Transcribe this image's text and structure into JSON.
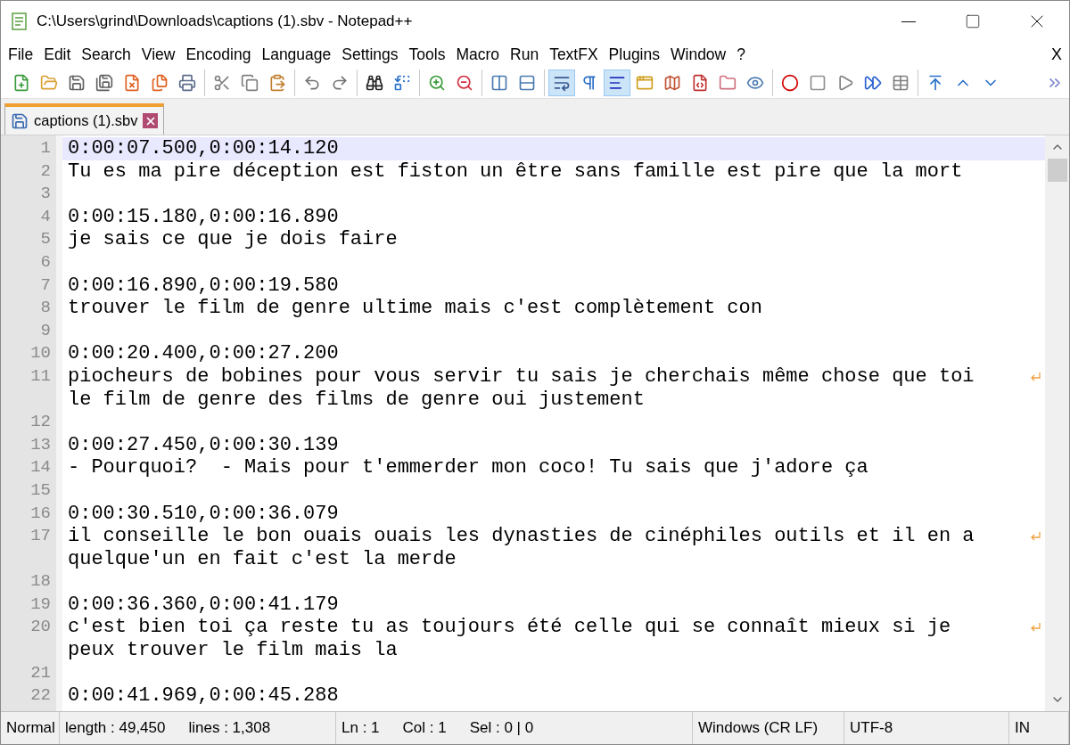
{
  "window": {
    "title": "C:\\Users\\grind\\Downloads\\captions (1).sbv - Notepad++"
  },
  "menu": {
    "items": [
      "File",
      "Edit",
      "Search",
      "View",
      "Encoding",
      "Language",
      "Settings",
      "Tools",
      "Macro",
      "Run",
      "TextFX",
      "Plugins",
      "Window",
      "?"
    ],
    "close_label": "X"
  },
  "toolbar": [
    [
      {
        "kind": "new",
        "pressed": false
      },
      {
        "kind": "open",
        "pressed": false
      },
      {
        "kind": "save",
        "pressed": false
      },
      {
        "kind": "saveall",
        "pressed": false
      },
      {
        "kind": "close",
        "pressed": false
      },
      {
        "kind": "closeall",
        "pressed": false
      },
      {
        "kind": "print",
        "pressed": false
      }
    ],
    [
      {
        "kind": "cut",
        "pressed": false
      },
      {
        "kind": "copy",
        "pressed": false
      },
      {
        "kind": "paste",
        "pressed": false
      }
    ],
    [
      {
        "kind": "undo",
        "pressed": false
      },
      {
        "kind": "redo",
        "pressed": false
      }
    ],
    [
      {
        "kind": "find",
        "pressed": false
      },
      {
        "kind": "replace",
        "pressed": false
      }
    ],
    [
      {
        "kind": "zoomin",
        "pressed": false
      },
      {
        "kind": "zoomout",
        "pressed": false
      }
    ],
    [
      {
        "kind": "syncv",
        "pressed": false
      },
      {
        "kind": "synch",
        "pressed": false
      }
    ],
    [
      {
        "kind": "wrap",
        "pressed": true
      },
      {
        "kind": "allchars",
        "pressed": false
      },
      {
        "kind": "indent",
        "pressed": true
      },
      {
        "kind": "udl",
        "pressed": false
      },
      {
        "kind": "docmap",
        "pressed": false
      },
      {
        "kind": "funclist",
        "pressed": false
      },
      {
        "kind": "folder",
        "pressed": false
      },
      {
        "kind": "monitor",
        "pressed": false
      }
    ],
    [
      {
        "kind": "record",
        "pressed": false
      },
      {
        "kind": "stop",
        "pressed": false
      },
      {
        "kind": "play",
        "pressed": false
      },
      {
        "kind": "playmulti",
        "pressed": false
      },
      {
        "kind": "savemacro",
        "pressed": false
      }
    ],
    [
      {
        "kind": "top",
        "pressed": false
      },
      {
        "kind": "up",
        "pressed": false
      },
      {
        "kind": "down",
        "pressed": false
      }
    ]
  ],
  "tabs": [
    {
      "label": "captions (1).sbv",
      "selected": true
    }
  ],
  "lines": [
    {
      "number": "1",
      "current": true,
      "parts": [
        "0:00:07.500,0:00:14.120"
      ]
    },
    {
      "number": "2",
      "current": false,
      "parts": [
        "Tu es ma pire déception est fiston un être sans famille est pire que la mort"
      ]
    },
    {
      "number": "3",
      "current": false
    },
    {
      "number": "4",
      "current": false,
      "parts": [
        "0:00:15.180,0:00:16.890"
      ]
    },
    {
      "number": "5",
      "current": false,
      "parts": [
        "je sais ce que je dois faire"
      ]
    },
    {
      "number": "6",
      "current": false
    },
    {
      "number": "7",
      "current": false,
      "parts": [
        "0:00:16.890,0:00:19.580"
      ]
    },
    {
      "number": "8",
      "current": false,
      "parts": [
        "trouver le film de genre ultime mais c'est complètement con"
      ]
    },
    {
      "number": "9",
      "current": false
    },
    {
      "number": "10",
      "current": false,
      "parts": [
        "0:00:20.400,0:00:27.200"
      ]
    },
    {
      "number": "11",
      "current": false,
      "parts": [
        "piocheurs de bobines pour vous servir tu sais je cherchais même chose que toi",
        "le film de genre des films de genre oui justement"
      ]
    },
    {
      "number": "12",
      "current": false
    },
    {
      "number": "13",
      "current": false,
      "parts": [
        "0:00:27.450,0:00:30.139"
      ]
    },
    {
      "number": "14",
      "current": false,
      "parts": [
        "- Pourquoi?  - Mais pour t'emmerder mon coco! Tu sais que j'adore ça"
      ]
    },
    {
      "number": "15",
      "current": false
    },
    {
      "number": "16",
      "current": false,
      "parts": [
        "0:00:30.510,0:00:36.079"
      ]
    },
    {
      "number": "17",
      "current": false,
      "parts": [
        "il conseille le bon ouais ouais les dynasties de cinéphiles outils et il en a",
        "quelque'un en fait c'est la merde"
      ]
    },
    {
      "number": "18",
      "current": false
    },
    {
      "number": "19",
      "current": false,
      "parts": [
        "0:00:36.360,0:00:41.179"
      ]
    },
    {
      "number": "20",
      "current": false,
      "parts": [
        "c'est bien toi ça reste tu as toujours été celle qui se connaît mieux si je",
        "peux trouver le film mais la"
      ]
    },
    {
      "number": "21",
      "current": false
    },
    {
      "number": "22",
      "current": false,
      "parts": [
        "0:00:41.969,0:00:45.288"
      ]
    }
  ],
  "status_bar": [
    [
      "Normal"
    ],
    [
      "length : 49,450",
      "lines : 1,308"
    ],
    [
      "Ln : 1",
      "Col : 1",
      "Sel : 0 | 0"
    ],
    [
      "Windows (CR LF)"
    ],
    [
      "UTF-8"
    ],
    [
      "IN"
    ]
  ]
}
